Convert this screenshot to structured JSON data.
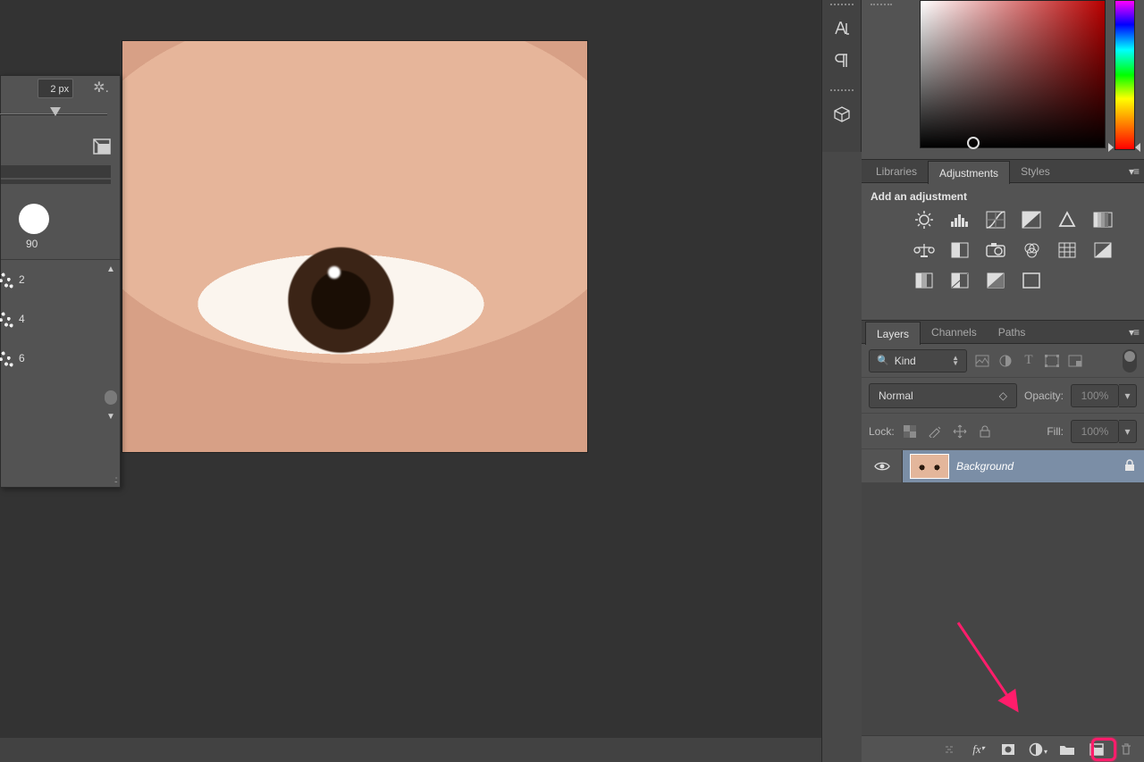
{
  "brush_panel": {
    "size_field": "2 px",
    "preview_size": "90",
    "presets": [
      "2",
      "4",
      "6"
    ]
  },
  "tabs_panel1": {
    "labels": [
      "Libraries",
      "Adjustments",
      "Styles"
    ],
    "active_index": 1,
    "title": "Add an adjustment"
  },
  "tabs_panel2": {
    "labels": [
      "Layers",
      "Channels",
      "Paths"
    ],
    "active_index": 0
  },
  "layers_panel": {
    "filter_kind": "Kind",
    "blend_mode": "Normal",
    "opacity_label": "Opacity:",
    "opacity_value": "100%",
    "lock_label": "Lock:",
    "fill_label": "Fill:",
    "fill_value": "100%",
    "layer": {
      "name": "Background"
    }
  },
  "highlight_color": "#ff1d6b"
}
